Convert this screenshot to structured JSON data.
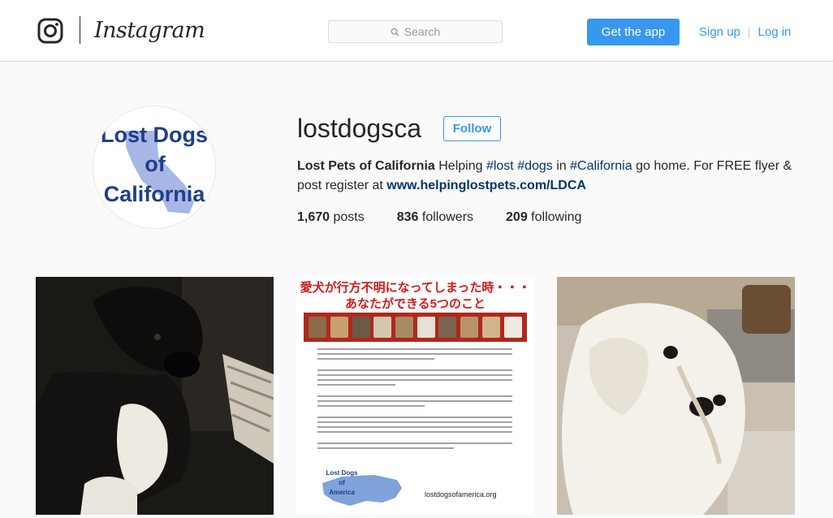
{
  "header": {
    "wordmark": "Instagram",
    "search_placeholder": "Search",
    "get_app_label": "Get the app",
    "signup_label": "Sign up",
    "login_label": "Log in",
    "separator": "|"
  },
  "profile": {
    "avatar_text_line1": "Lost Dogs",
    "avatar_text_line2": "of",
    "avatar_text_line3": "California",
    "username": "lostdogsca",
    "follow_label": "Follow",
    "bio": {
      "name": "Lost Pets of California",
      "t1": " Helping ",
      "tag1": "#lost",
      "t2": " ",
      "tag2": "#dogs",
      "t3": " in ",
      "tag3": "#California",
      "t4": " go home. For FREE flyer & post register at ",
      "link": "www.helpinglostpets.com/LDCA"
    },
    "stats": {
      "posts_count": "1,670",
      "posts_label": " posts",
      "followers_count": "836",
      "followers_label": " followers",
      "following_count": "209",
      "following_label": " following"
    }
  },
  "posts": {
    "flyer_title_1": "愛犬が行方不明になってしまった時・・・",
    "flyer_title_2": "あなたができる5つのこと",
    "flyer_map_label_1": "Lost Dogs",
    "flyer_map_label_2": "of",
    "flyer_map_label_3": "America",
    "flyer_site": "lostdogsofamerica.org"
  },
  "colors": {
    "accent": "#3897f0",
    "link_dark": "#003569",
    "avatar_text": "#1f3d8c",
    "avatar_state": "#a9b7e6"
  }
}
